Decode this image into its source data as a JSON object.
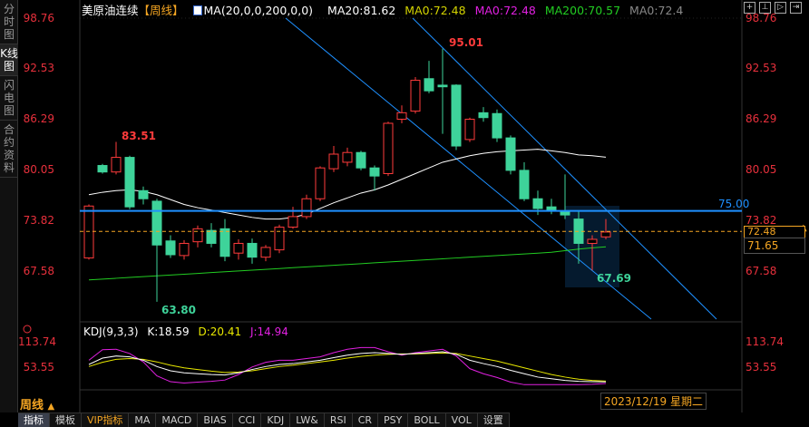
{
  "sidebar": {
    "tabs": [
      "分时图",
      "K线图",
      "闪电图",
      "合约资料"
    ],
    "active": 1
  },
  "header": {
    "symbol": "美原油连续",
    "period_tag": "【周线】",
    "ma_def": "MA(20,0,0,200,0,0)",
    "ma20": "MA20:81.62",
    "ma0a": "MA0:72.48",
    "ma0b": "MA0:72.48",
    "ma200": "MA200:70.57",
    "ma0c": "MA0:72.4"
  },
  "colors": {
    "up": "#ff3b3b",
    "down": "#3ed39a",
    "ma20": "#ffffff",
    "ma200": "#22cc22",
    "hline": "#1e90ff",
    "last": "#f5a623",
    "k": "#ffffff",
    "d": "#e8e800",
    "j": "#e020e0"
  },
  "toolbar_icons": [
    "crosshair-icon",
    "zoom-in-icon",
    "zoom-out-icon",
    "move-right-icon"
  ],
  "price_axis": {
    "labels": [
      "98.76",
      "92.53",
      "86.29",
      "80.05",
      "73.82",
      "67.58"
    ]
  },
  "annotations": {
    "high": "95.01",
    "left_high": "83.51",
    "low": "63.80",
    "recent_low": "67.69",
    "hline": "75.00",
    "last_partial": "72.48",
    "current": "71.65"
  },
  "kdj": {
    "title": "KDJ(9,3,3)",
    "k": "K:18.59",
    "d": "D:20.41",
    "j": "J:14.94",
    "axis": [
      "113.74",
      "53.55"
    ]
  },
  "period": "周线",
  "period_arrow": "▲",
  "date": "2023/12/19 星期二",
  "bottom_tabs": [
    "指标",
    "模板",
    "VIP指标",
    "MA",
    "MACD",
    "BIAS",
    "CCI",
    "KDJ",
    "LW&",
    "RSI",
    "CR",
    "PSY",
    "BOLL",
    "VOL",
    "设置"
  ],
  "chart_data": {
    "type": "candlestick",
    "title": "美原油连续 周线",
    "ylim": [
      63.0,
      98.76
    ],
    "candles": [
      [
        69.2,
        75.8,
        69,
        75.6
      ],
      [
        80.6,
        80.8,
        79.6,
        79.8
      ],
      [
        79.8,
        83.51,
        79.5,
        81.6
      ],
      [
        81.6,
        81.8,
        75.2,
        75.5
      ],
      [
        77.5,
        78,
        75.8,
        76.5
      ],
      [
        76.2,
        76.5,
        63.8,
        70.8
      ],
      [
        71.3,
        72,
        69.2,
        69.6
      ],
      [
        69.5,
        71.4,
        69,
        71
      ],
      [
        71.2,
        73.2,
        70.5,
        72.8
      ],
      [
        72.6,
        73.5,
        70.5,
        71
      ],
      [
        72.8,
        74,
        68.8,
        69.4
      ],
      [
        69.8,
        71.5,
        69,
        71
      ],
      [
        71,
        71.6,
        68.5,
        69.3
      ],
      [
        69.3,
        70.8,
        68.8,
        70.5
      ],
      [
        70.2,
        73.3,
        69.8,
        73
      ],
      [
        73,
        75.5,
        72.8,
        74.3
      ],
      [
        74.3,
        77,
        74,
        76.5
      ],
      [
        76.5,
        80.5,
        76.2,
        80.3
      ],
      [
        80.2,
        83,
        79.8,
        82
      ],
      [
        81,
        82.8,
        80.5,
        82.2
      ],
      [
        82.2,
        82.4,
        80,
        80.3
      ],
      [
        80.3,
        80.6,
        77.5,
        79.3
      ],
      [
        79.6,
        86,
        79.3,
        85.8
      ],
      [
        86.3,
        88,
        85.8,
        87.1
      ],
      [
        87.3,
        91.5,
        87,
        91.1
      ],
      [
        91.3,
        93.5,
        89.5,
        89.8
      ],
      [
        90.5,
        95.01,
        84.5,
        90.3
      ],
      [
        90.5,
        90.6,
        82.5,
        83
      ],
      [
        83.8,
        86.5,
        83.5,
        86.3
      ],
      [
        87.1,
        87.8,
        86,
        86.5
      ],
      [
        87,
        87.5,
        83.5,
        84
      ],
      [
        84,
        84.3,
        79.5,
        80
      ],
      [
        80,
        81,
        76.2,
        76.5
      ],
      [
        76.5,
        77.5,
        74.5,
        75.3
      ],
      [
        75.5,
        76.5,
        74.6,
        75
      ],
      [
        75,
        79.5,
        74,
        74.5
      ],
      [
        74,
        75,
        68.5,
        71
      ],
      [
        71,
        72,
        67.69,
        71.5
      ],
      [
        71.8,
        74,
        71.5,
        72.4
      ]
    ],
    "ma20": [
      77,
      77.3,
      77.5,
      77.6,
      77.4,
      77,
      76.4,
      75.8,
      75.4,
      75.1,
      74.8,
      74.5,
      74.2,
      74,
      74,
      74.2,
      74.6,
      75.3,
      76,
      76.6,
      77.2,
      77.6,
      78.2,
      78.9,
      79.6,
      80.3,
      81,
      81.4,
      81.8,
      82.1,
      82.3,
      82.4,
      82.5,
      82.6,
      82.4,
      82.2,
      81.9,
      81.8,
      81.62
    ],
    "ma200": [
      66.5,
      66.6,
      66.7,
      66.8,
      66.9,
      67,
      67.1,
      67.2,
      67.3,
      67.4,
      67.5,
      67.6,
      67.7,
      67.8,
      67.9,
      68,
      68.1,
      68.2,
      68.3,
      68.4,
      68.5,
      68.6,
      68.7,
      68.8,
      68.9,
      69,
      69.1,
      69.2,
      69.3,
      69.4,
      69.5,
      69.6,
      69.7,
      69.8,
      69.9,
      70.1,
      70.3,
      70.45,
      70.57
    ],
    "hline": 75.0,
    "last_price": 72.48,
    "kdj_ylim": [
      10,
      125
    ],
    "kdj_k": [
      60,
      75,
      80,
      78,
      70,
      55,
      45,
      40,
      38,
      36,
      35,
      40,
      48,
      55,
      60,
      62,
      66,
      70,
      76,
      82,
      86,
      88,
      86,
      84,
      86,
      88,
      90,
      84,
      70,
      62,
      55,
      46,
      38,
      30,
      26,
      22,
      20,
      19,
      18.59
    ],
    "kdj_d": [
      55,
      65,
      72,
      74,
      72,
      66,
      58,
      52,
      48,
      44,
      41,
      42,
      45,
      50,
      55,
      58,
      62,
      66,
      70,
      75,
      79,
      82,
      84,
      85,
      85,
      86,
      87,
      86,
      80,
      74,
      68,
      60,
      52,
      44,
      36,
      30,
      25,
      22,
      20.41
    ],
    "kdj_j": [
      70,
      95,
      96,
      86,
      66,
      33,
      19,
      16,
      18,
      20,
      23,
      36,
      54,
      65,
      70,
      70,
      74,
      78,
      88,
      96,
      100,
      100,
      90,
      82,
      88,
      92,
      96,
      80,
      50,
      38,
      29,
      18,
      12,
      12,
      12,
      12,
      12,
      13,
      14.94
    ]
  }
}
